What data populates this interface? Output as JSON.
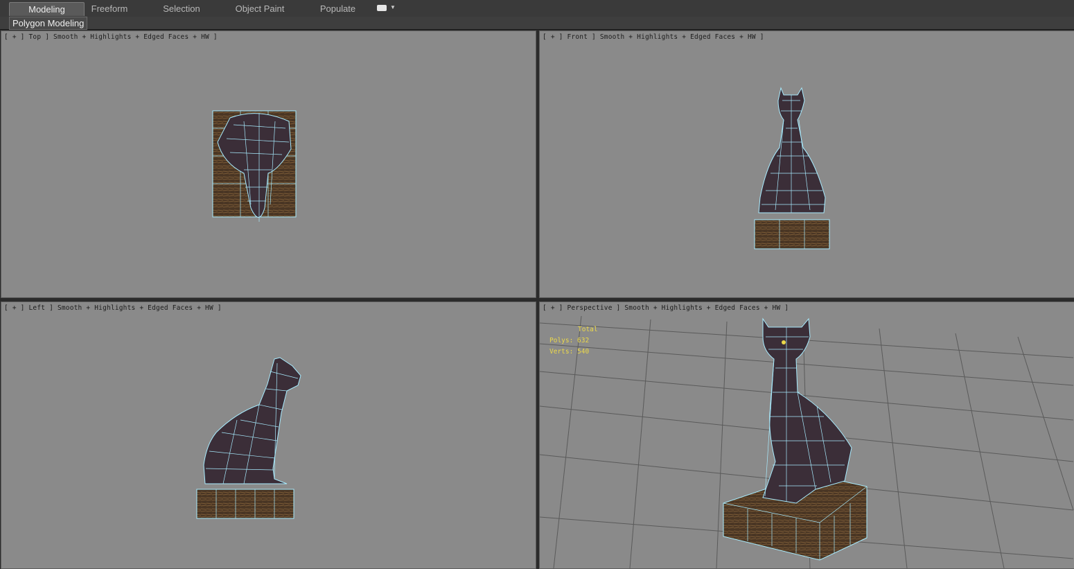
{
  "ribbon": {
    "tabs": [
      {
        "label": "Modeling",
        "active": true
      },
      {
        "label": "Freeform",
        "active": false
      },
      {
        "label": "Selection",
        "active": false
      },
      {
        "label": "Object Paint",
        "active": false
      },
      {
        "label": "Populate",
        "active": false
      }
    ],
    "dropdown_icon": "ribbon-options-icon",
    "panel_label": "Polygon Modeling"
  },
  "viewports": {
    "top": {
      "label": "[ + ] Top ] Smooth + Highlights + Edged Faces + HW ]"
    },
    "front": {
      "label": "[ + ] Front ] Smooth + Highlights + Edged Faces + HW ]"
    },
    "left": {
      "label": "[ + ] Left ] Smooth + Highlights + Edged Faces + HW ]"
    },
    "perspective": {
      "label": "[ + ] Perspective ] Smooth + Highlights + Edged Faces + HW ]",
      "stats": {
        "header": "Total",
        "polys": "Polys: 632",
        "verts": "Verts: 540"
      }
    }
  },
  "colors": {
    "viewport_bg": "#8a8a8a",
    "wire": "#a8ecff",
    "stats_text": "#ecd94a",
    "statue_body": "#3b2e38",
    "pedestal": "#4a3624"
  }
}
